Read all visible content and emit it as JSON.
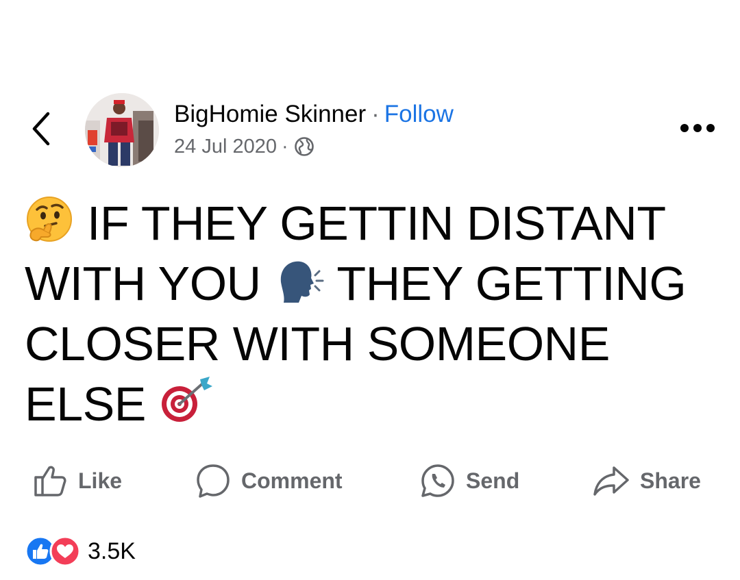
{
  "post": {
    "author": "BigHomie Skinner",
    "separator": "·",
    "follow_label": "Follow",
    "date": "24 Jul 2020",
    "meta_separator": "·",
    "privacy_icon": "globe-icon",
    "text_lines": [
      "IF THEY GETTIN DISTANT",
      "WITH YOU",
      "THEY GETTING",
      "CLOSER WITH SOMEONE",
      "ELSE"
    ],
    "emojis": [
      "thinking-face",
      "speaking-head",
      "direct-hit"
    ]
  },
  "actions": {
    "like_label": "Like",
    "comment_label": "Comment",
    "send_label": "Send",
    "share_label": "Share"
  },
  "reactions": {
    "types": [
      "like",
      "love"
    ],
    "count": "3.5K"
  },
  "colors": {
    "follow": "#1b74e4",
    "secondary_text": "#65676b",
    "like_blue": "#1877f2",
    "love_red": "#f33e58"
  }
}
